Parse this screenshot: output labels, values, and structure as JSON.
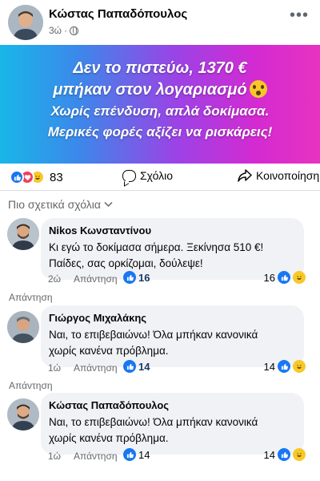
{
  "post": {
    "author": "Κώστας Παπαδόπουλος",
    "time": "3ώ",
    "more_icon": "more-icon"
  },
  "banner": {
    "line1": "Δεν το πιστεύω, 1370 €",
    "line2": "μπήκαν στον λογαριασμό",
    "line3": "Χωρίς επένδυση, απλά δοκίμασα.",
    "line4": "Μερικές φορές αξίζει να ρισκάρεις!",
    "emoji": "shocked-emoji",
    "gradient_colors": [
      "#18b7e8",
      "#9b43e6",
      "#e733c0"
    ]
  },
  "stats": {
    "reactions_count": "83",
    "reaction_icons": [
      "like-icon",
      "love-icon",
      "haha-icon"
    ],
    "comment_label": "Σχόλιο",
    "share_label": "Κοινοποίηση"
  },
  "comments_filter": "Πιο σχετικά σχόλια",
  "comments": [
    {
      "name": "Nikos Κωνσταντίνου",
      "lines": [
        "Κι εγώ το δοκίμασα σήμερα. Ξεκίνησα 510 €!",
        "Παίδες, σας ορκίζομαι, δούλεψε!"
      ],
      "time": "2ώ",
      "reply_label": "Απάντηση",
      "likes": "16",
      "right_count": "16",
      "reply_link": "Απάντηση"
    },
    {
      "name": "Γιώργος Μιχαλάκης",
      "lines": [
        "Ναι, το επιβεβαιώνω! Όλα μπήκαν κανονικά",
        "χωρίς κανένα πρόβλημα."
      ],
      "time": "1ώ",
      "reply_label": "Απάντηση",
      "likes": "14",
      "right_count": "14",
      "reply_link": "Απάντηση"
    },
    {
      "name": "Κώστας Παπαδόπουλος",
      "lines": [
        "Ναι, το επιβεβαιώνω! Όλα μπήκαν κανονικά",
        "χωρίς κανένα πρόβλημα."
      ],
      "time": "1ώ",
      "reply_label": "Απάντηση",
      "likes": "14",
      "right_count": "14"
    }
  ],
  "colors": {
    "like_blue": "#1877f2",
    "love_red": "#f33e58",
    "haha_yellow": "#f7c928",
    "bubble_bg": "#f0f2f5",
    "muted_text": "#65676b"
  }
}
